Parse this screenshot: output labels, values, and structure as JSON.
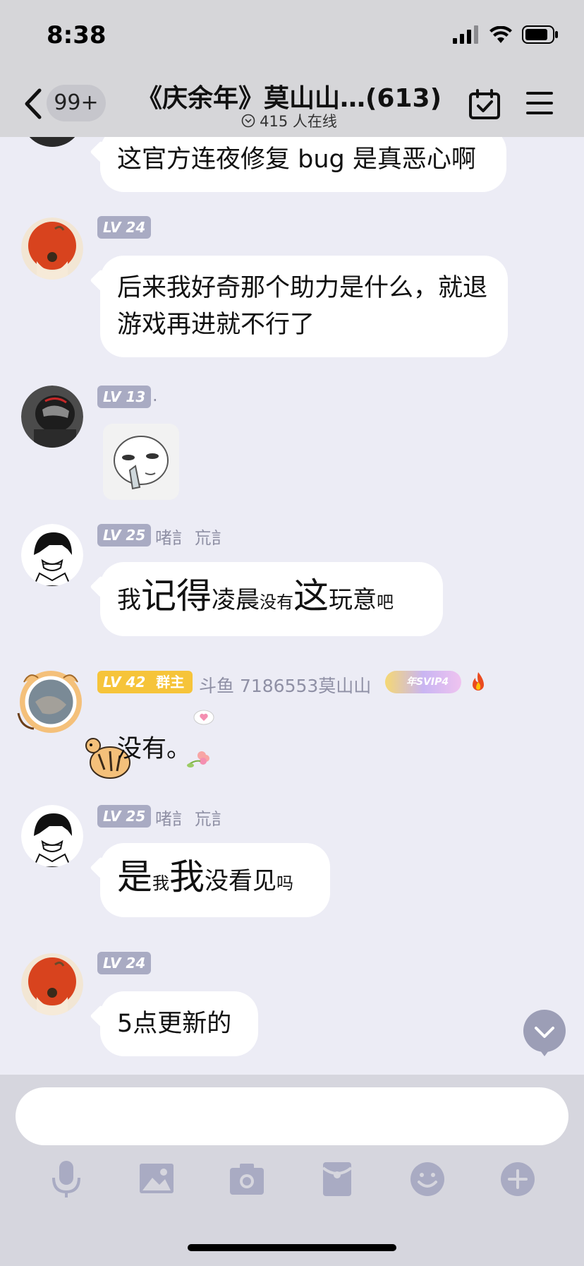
{
  "status": {
    "time": "8:38"
  },
  "header": {
    "unread_count": "99+",
    "title": "《庆余年》莫山山…(613)",
    "online": "415 人在线"
  },
  "messages": [
    {
      "text": "这官方连夜修复 bug 是真恶心啊"
    },
    {
      "level": "LV 24",
      "text": "后来我好奇那个助力是什么，就退游戏再进就不行了"
    },
    {
      "level": "LV 13",
      "nick": ".",
      "sticker": "sticker-face"
    },
    {
      "level": "LV 25",
      "nick": "啫訁 巟訁",
      "parts": [
        "我",
        "记得",
        "凌晨",
        "没有",
        "这",
        "玩意",
        "吧"
      ]
    },
    {
      "level": "LV 42",
      "role": "群主",
      "nick": "斗鱼 7186553莫山山",
      "badge": "年SVIP4",
      "text": "没有。"
    },
    {
      "level": "LV 25",
      "nick": "啫訁 巟訁",
      "parts": [
        "是",
        "我",
        "我",
        "没看见",
        "吗"
      ]
    },
    {
      "level": "LV 24",
      "text": "5点更新的"
    }
  ],
  "composer": {
    "placeholder": ""
  },
  "toolbar": [
    "microphone-icon",
    "image-icon",
    "camera-icon",
    "red-packet-icon",
    "emoji-icon",
    "plus-icon"
  ]
}
